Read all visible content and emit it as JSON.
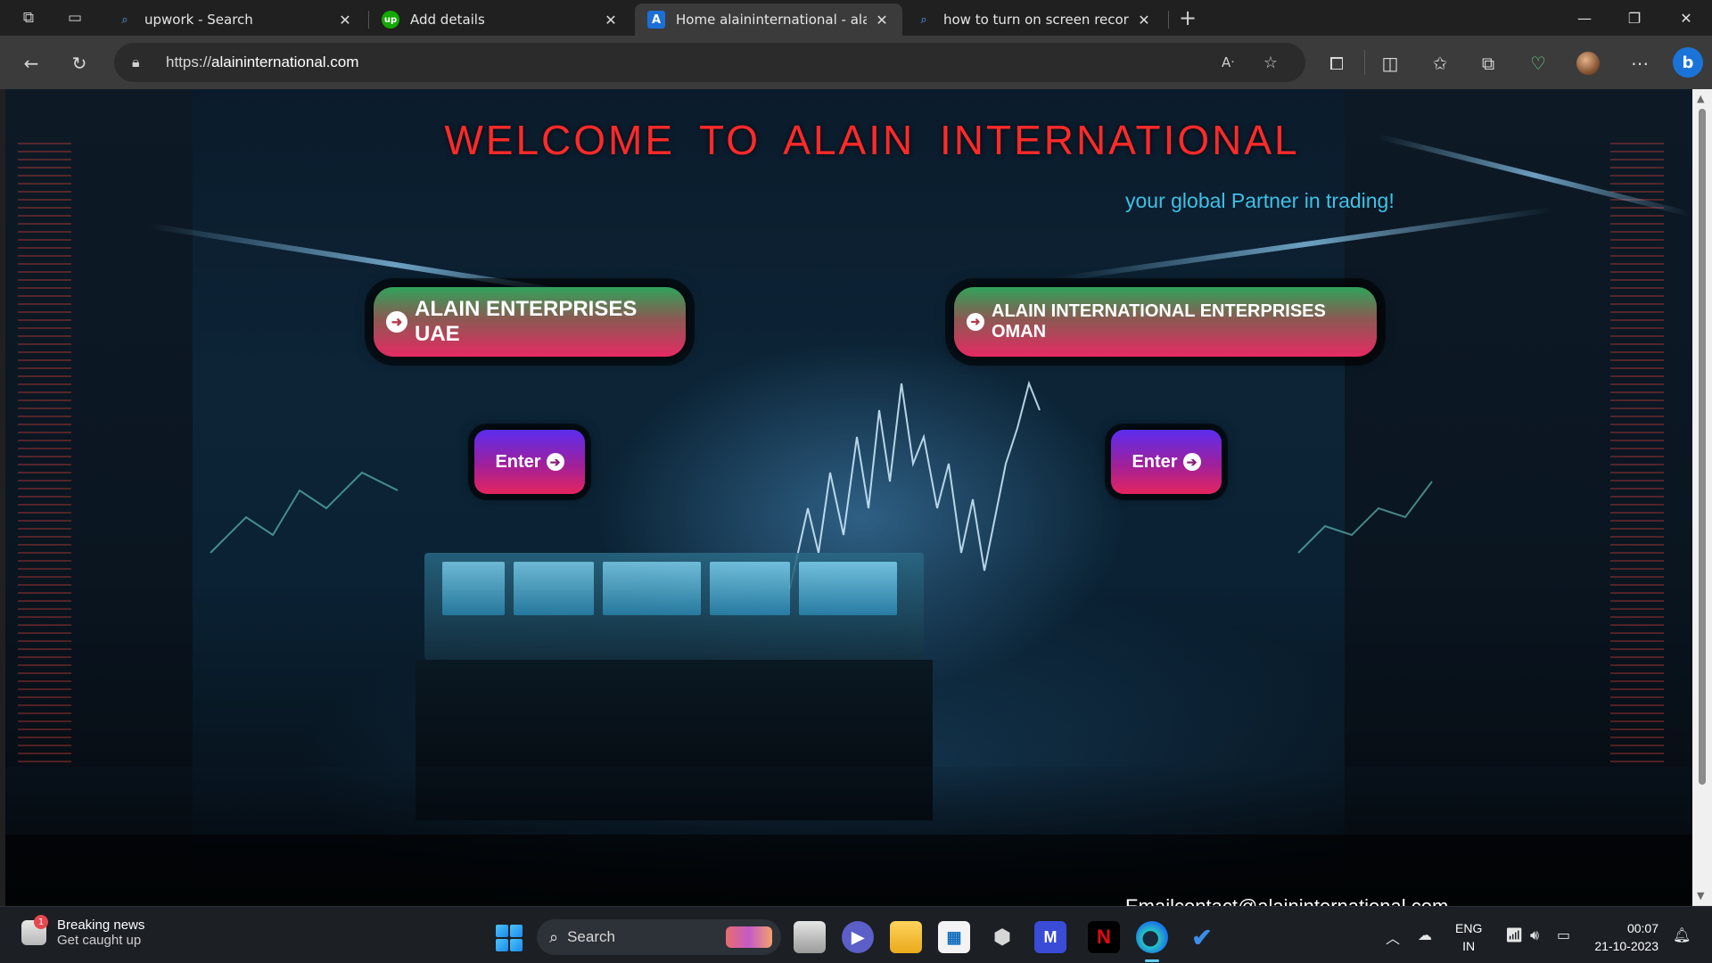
{
  "tabs": [
    {
      "title": "upwork - Search",
      "favicon": "search-icon",
      "active": false
    },
    {
      "title": "Add details",
      "favicon": "upwork-icon",
      "favicon_text": "up",
      "active": false
    },
    {
      "title": "Home alaininternational - alainin",
      "favicon": "site-logo-icon",
      "active": true
    },
    {
      "title": "how to turn on screen recording",
      "favicon": "search-icon",
      "active": false
    }
  ],
  "address_bar": {
    "url_prefix": "https://",
    "url_host": "alaininternational.com"
  },
  "page": {
    "welcome": "WELCOME  TO  ALAIN  INTERNATIONAL",
    "tagline": "your global Partner in trading!",
    "enterprise_uae": "ALAIN ENTERPRISES UAE",
    "enterprise_oman": "ALAIN INTERNATIONAL ENTERPRISES OMAN",
    "enter_label": "Enter",
    "email": "Emailcontact@alaininternational.com"
  },
  "taskbar": {
    "news_title": "Breaking news",
    "news_subtitle": "Get caught up",
    "news_badge": "1",
    "search_placeholder": "Search",
    "language": "ENG",
    "region": "IN",
    "time": "00:07",
    "date": "21-10-2023"
  },
  "colors": {
    "welcome": "#ff2a2a",
    "tagline": "#3fc1e6",
    "taskbar_accent": "#60cdff"
  }
}
